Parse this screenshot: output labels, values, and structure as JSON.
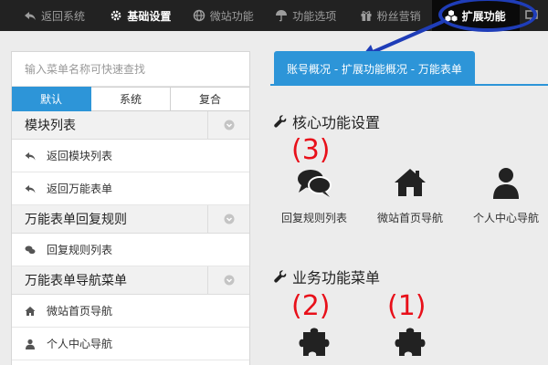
{
  "topnav": {
    "items": [
      {
        "label": "返回系统",
        "icon": "back-icon"
      },
      {
        "label": "基础设置",
        "icon": "gear-icon"
      },
      {
        "label": "微站功能",
        "icon": "globe-icon"
      },
      {
        "label": "功能选项",
        "icon": "umbrella-icon"
      },
      {
        "label": "粉丝营销",
        "icon": "gift-icon"
      },
      {
        "label": "扩展功能",
        "icon": "cubes-icon"
      }
    ],
    "active_index": 5
  },
  "sidebar": {
    "search_placeholder": "输入菜单名称可快速查找",
    "segments": [
      "默认",
      "系统",
      "复合"
    ],
    "selected_segment": "默认",
    "groups": [
      {
        "title": "模块列表",
        "items": [
          {
            "label": "返回模块列表",
            "icon": "reply-icon"
          },
          {
            "label": "返回万能表单",
            "icon": "reply-icon"
          }
        ]
      },
      {
        "title": "万能表单回复规则",
        "items": [
          {
            "label": "回复规则列表",
            "icon": "comments-icon"
          }
        ]
      },
      {
        "title": "万能表单导航菜单",
        "items": [
          {
            "label": "微站首页导航",
            "icon": "home-icon"
          },
          {
            "label": "个人中心导航",
            "icon": "user-icon"
          }
        ]
      }
    ]
  },
  "main": {
    "breadcrumb_tab": "账号概况 - 扩展功能概况 - 万能表单",
    "core_section": {
      "title": "核心功能设置",
      "tiles": [
        {
          "label": "回复规则列表",
          "icon": "comments-icon"
        },
        {
          "label": "微站首页导航",
          "icon": "home-icon"
        },
        {
          "label": "个人中心导航",
          "icon": "user-icon"
        }
      ]
    },
    "business_section": {
      "title": "业务功能菜单",
      "tiles": [
        {
          "label": "",
          "icon": "puzzle-icon"
        },
        {
          "label": "",
          "icon": "puzzle-icon"
        }
      ]
    }
  },
  "annotations": [
    "(3)",
    "(2)",
    "(1)"
  ],
  "colors": {
    "accent": "#2d95d8",
    "nav_bg": "#222222",
    "highlight": "#1f3db8",
    "annotation": "#e8101a"
  }
}
